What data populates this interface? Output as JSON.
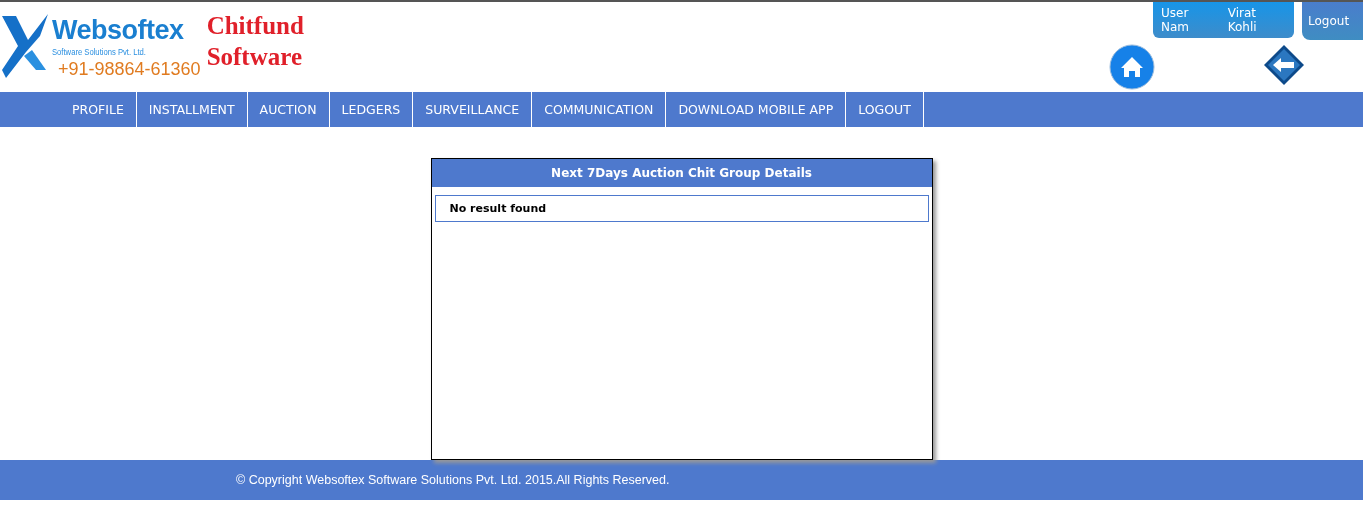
{
  "logo": {
    "brand": "Websoftex",
    "tagline": "Software Solutions Pvt. Ltd.",
    "phone": "+91-98864-61360",
    "product_line_1": "Chitfund",
    "product_line_2": "Software"
  },
  "user_box": {
    "label": "User Nam",
    "name": "Virat Kohli"
  },
  "logout_button": "Logout",
  "nav": [
    {
      "label": "PROFILE"
    },
    {
      "label": "INSTALLMENT"
    },
    {
      "label": "AUCTION"
    },
    {
      "label": "LEDGERS"
    },
    {
      "label": "SURVEILLANCE"
    },
    {
      "label": "COMMUNICATION"
    },
    {
      "label": "DOWNLOAD MOBILE APP"
    },
    {
      "label": "LOGOUT"
    }
  ],
  "panel": {
    "title": "Next 7Days Auction Chit Group Details",
    "message": "No result found"
  },
  "footer": "© Copyright Websoftex Software Solutions Pvt. Ltd. 2015.All Rights Reserved."
}
